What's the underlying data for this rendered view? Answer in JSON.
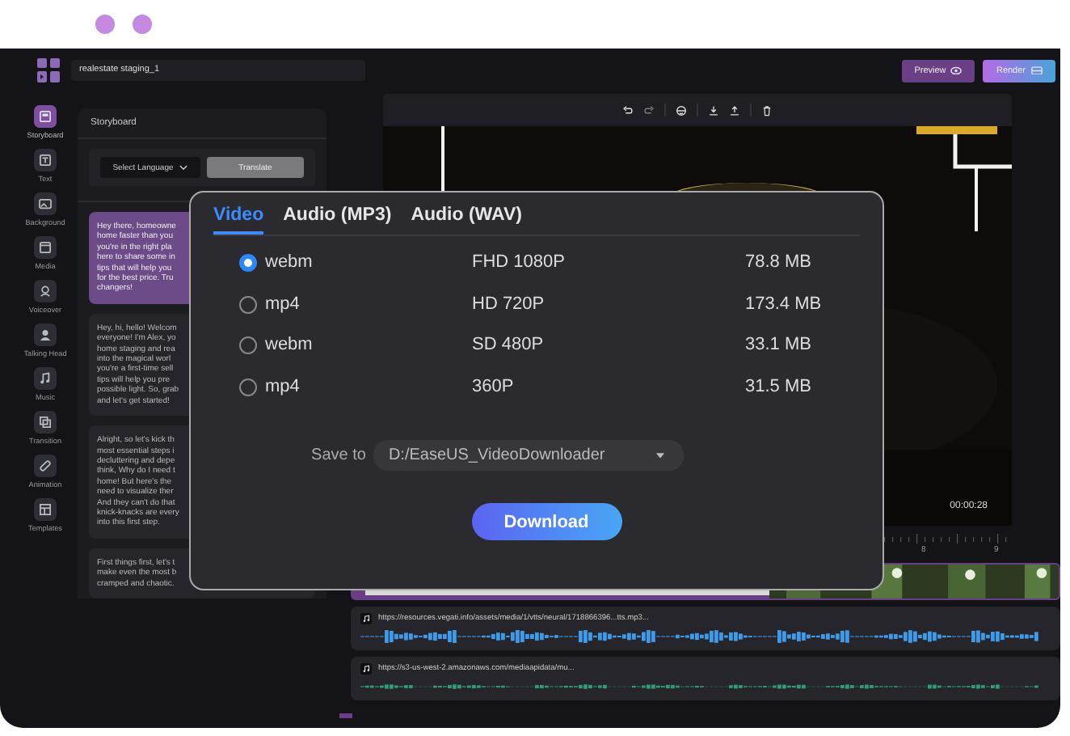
{
  "header": {
    "project_name": "realestate staging_1",
    "buttons": [
      {
        "label": "Preview",
        "kind": "preview"
      },
      {
        "label": "Render",
        "kind": "render"
      }
    ]
  },
  "sidebar": {
    "items": [
      {
        "label": "Storyboard",
        "selected": true
      },
      {
        "label": "Text",
        "selected": false
      },
      {
        "label": "Background",
        "selected": false
      },
      {
        "label": "Media",
        "selected": false
      },
      {
        "label": "Voiceover",
        "selected": false
      },
      {
        "label": "Talking Head",
        "selected": false
      },
      {
        "label": "Music",
        "selected": false
      },
      {
        "label": "Transition",
        "selected": false
      },
      {
        "label": "Animation",
        "selected": false
      },
      {
        "label": "Templates",
        "selected": false
      }
    ]
  },
  "storyboard": {
    "title": "Storyboard",
    "language_select": "Select Language",
    "translate_button": "Translate",
    "cards": [
      {
        "selected": true,
        "lines": [
          "Hey there, homeowne",
          "home faster than you",
          "you're in the right pla",
          "here to share some in",
          "tips that will help you",
          "for the best price. Tru",
          "changers!"
        ]
      },
      {
        "selected": false,
        "lines": [
          "Hey, hi, hello! Welcom",
          "everyone! I'm Alex, yo",
          "home staging and rea",
          "into the magical worl",
          "you're a first-time sell",
          "tips will help you pre",
          "possible light. So, grab",
          "and let's get started!"
        ]
      },
      {
        "selected": false,
        "lines": [
          "Alright, so let's kick th",
          "most essential steps i",
          "decluttering and depe",
          "think, Why do I need t",
          "home! But here's the",
          "need to visualize ther",
          "And they can't do that",
          "knick-knacks are every",
          "into this first step."
        ]
      },
      {
        "selected": false,
        "lines": [
          "First things first, let's t",
          "make even the most b",
          "cramped and chaotic."
        ]
      }
    ]
  },
  "preview": {
    "time": "00:00:28"
  },
  "timeline": {
    "ruler_labels": [
      "8",
      "9"
    ],
    "audio_tracks": [
      {
        "url": "https://resources.vegati.info/assets/media/1/vtts/neural/1718866396...tts.mp3...",
        "color": "#3d9be9"
      },
      {
        "url": "https://s3-us-west-2.amazonaws.com/mediaapidata/mu...",
        "color": "#2e9d78"
      }
    ]
  },
  "dialog": {
    "tabs": [
      {
        "label": "Video",
        "selected": true
      },
      {
        "label": "Audio (MP3)",
        "selected": false
      },
      {
        "label": "Audio (WAV)",
        "selected": false
      }
    ],
    "options": [
      {
        "format": "webm",
        "quality": "FHD 1080P",
        "size": "78.8 MB",
        "selected": true
      },
      {
        "format": "mp4",
        "quality": "HD 720P",
        "size": "173.4 MB",
        "selected": false
      },
      {
        "format": "webm",
        "quality": "SD 480P",
        "size": "33.1 MB",
        "selected": false
      },
      {
        "format": "mp4",
        "quality": "360P",
        "size": "31.5 MB",
        "selected": false
      }
    ],
    "save_label": "Save to",
    "save_path": "D:/EaseUS_VideoDownloader",
    "download_button": "Download"
  }
}
